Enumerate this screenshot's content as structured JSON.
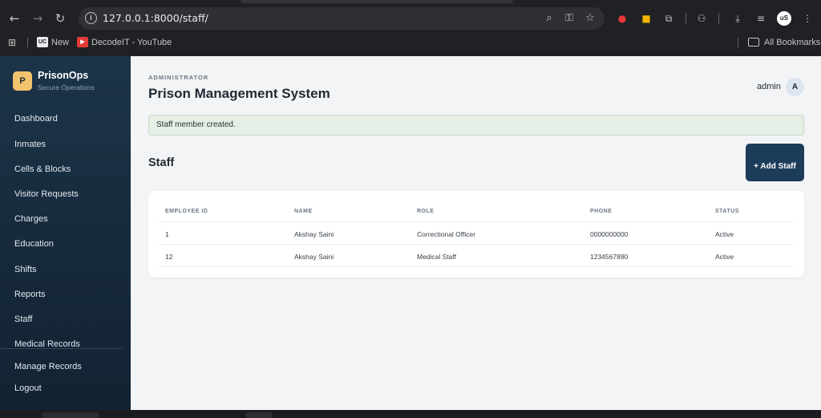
{
  "browser": {
    "url": "127.0.0.1:8000/staff/",
    "profile_initials": "uS",
    "bookmarks": {
      "items": [
        {
          "label": "New",
          "badge": "UC"
        },
        {
          "label": "DecodeIT - YouTube"
        }
      ],
      "all_bookmarks_label": "All Bookmarks"
    }
  },
  "app": {
    "brand": {
      "logo": "P",
      "name": "PrisonOps",
      "subtitle": "Secure Operations"
    },
    "nav": [
      "Dashboard",
      "Inmates",
      "Cells & Blocks",
      "Visitor Requests",
      "Charges",
      "Education",
      "Shifts",
      "Reports",
      "Staff",
      "Medical Records",
      "Manage Records",
      "Logout"
    ],
    "header": {
      "eyebrow": "ADMINISTRATOR",
      "title": "Prison Management System",
      "user_name": "admin",
      "user_avatar": "A"
    },
    "alert": "Staff member created.",
    "section_title": "Staff",
    "add_button": "+ Add Staff",
    "table": {
      "columns": [
        "EMPLOYEE ID",
        "NAME",
        "ROLE",
        "PHONE",
        "STATUS"
      ],
      "rows": [
        [
          "1",
          "Akshay Saini",
          "Correctional Officer",
          "0000000000",
          "Active"
        ],
        [
          "12",
          "Akshay Saini",
          "Medical Staff",
          "1234567890",
          "Active"
        ]
      ]
    }
  },
  "colors": {
    "sidebar": "#1c3449",
    "accent_button": "#1d3c5a",
    "alert_bg": "#e5efe5",
    "brand_logo": "#f2c46d"
  }
}
